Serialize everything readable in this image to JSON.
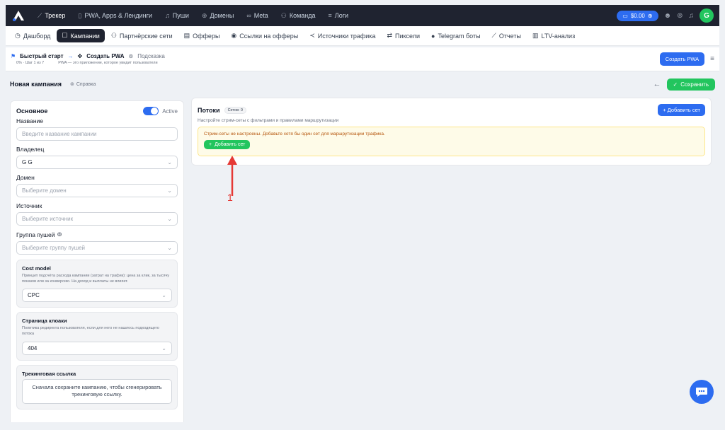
{
  "topbar": {
    "nav": [
      {
        "icon": "chart-line-icon",
        "glyph": "⟋",
        "label": "Трекер",
        "active": true
      },
      {
        "icon": "device-icon",
        "glyph": "▯",
        "label": "PWA, Apps & Лендинги"
      },
      {
        "icon": "bell-icon",
        "glyph": "♫",
        "label": "Пуши"
      },
      {
        "icon": "globe-icon",
        "glyph": "⊕",
        "label": "Домены"
      },
      {
        "icon": "infinity-icon",
        "glyph": "∞",
        "label": "Meta"
      },
      {
        "icon": "team-icon",
        "glyph": "⚇",
        "label": "Команда"
      },
      {
        "icon": "list-icon",
        "glyph": "≡",
        "label": "Логи"
      }
    ],
    "balance": "$0.00",
    "avatar": "G"
  },
  "subnav": [
    {
      "icon": "clock-icon",
      "glyph": "◷",
      "label": "Дашборд"
    },
    {
      "icon": "edit-icon",
      "glyph": "☐",
      "label": "Кампании",
      "active": true
    },
    {
      "icon": "partners-icon",
      "glyph": "⚇",
      "label": "Партнёрские сети"
    },
    {
      "icon": "offers-icon",
      "glyph": "▤",
      "label": "Офферы"
    },
    {
      "icon": "pin-icon",
      "glyph": "◉",
      "label": "Ссылки на офферы"
    },
    {
      "icon": "share-icon",
      "glyph": "≺",
      "label": "Источники трафика"
    },
    {
      "icon": "swap-icon",
      "glyph": "⇄",
      "label": "Пиксели"
    },
    {
      "icon": "telegram-icon",
      "glyph": "●",
      "label": "Telegram боты"
    },
    {
      "icon": "chart-icon",
      "glyph": "⟋",
      "label": "Отчеты"
    },
    {
      "icon": "bars-icon",
      "glyph": "▥",
      "label": "LTV-анализ"
    }
  ],
  "quick": {
    "title": "Быстрый старт",
    "step": "Создать PWA",
    "hint": "Подсказка",
    "progress": "0% · Шаг 1 из 7",
    "desc": "PWA — это приложение, которое увидит пользователи",
    "create_btn": "Создать PWA"
  },
  "campaign": {
    "title": "Новая кампания",
    "help": "Справка",
    "save": "Сохранить"
  },
  "form": {
    "section": "Основное",
    "active": "Active",
    "name_label": "Название",
    "name_placeholder": "Введите название кампании",
    "owner_label": "Владелец",
    "owner_value": "G G",
    "domain_label": "Домен",
    "domain_placeholder": "Выберите домен",
    "source_label": "Источник",
    "source_placeholder": "Выберите источник",
    "pushgroup_label": "Группа пушей",
    "pushgroup_placeholder": "Выберите группу пушей",
    "cost_title": "Cost model",
    "cost_desc": "Принцип подсчёта расхода кампании (затрат на трафик): цена за клик, за тысячу показов или за конверсию. На доход и выплаты не влияет.",
    "cost_value": "CPC",
    "cloak_title": "Страница клоаки",
    "cloak_desc": "Политика редиректа пользователя, если для него не нашлось подходящего потока",
    "cloak_value": "404",
    "tracking_title": "Трекинговая ссылка",
    "tracking_note": "Сначала сохраните кампанию, чтобы сгенерировать трекинговую ссылку."
  },
  "streams": {
    "title": "Потоки",
    "badge": "Сетов: 0",
    "subtitle": "Настройте стрим-сеты с фильтрами и правилами маршрутизации",
    "add_set": "Добавить сет",
    "warning": "Стрим-сеты не настроены. Добавьте хотя бы один сет для маршрутизации трафика.",
    "add_set_inner": "Добавить сет"
  },
  "annotation": {
    "number": "1"
  },
  "colors": {
    "accent": "#2d6cf0",
    "success": "#22c55e",
    "dark": "#1f2330",
    "annotation": "#e53935"
  }
}
